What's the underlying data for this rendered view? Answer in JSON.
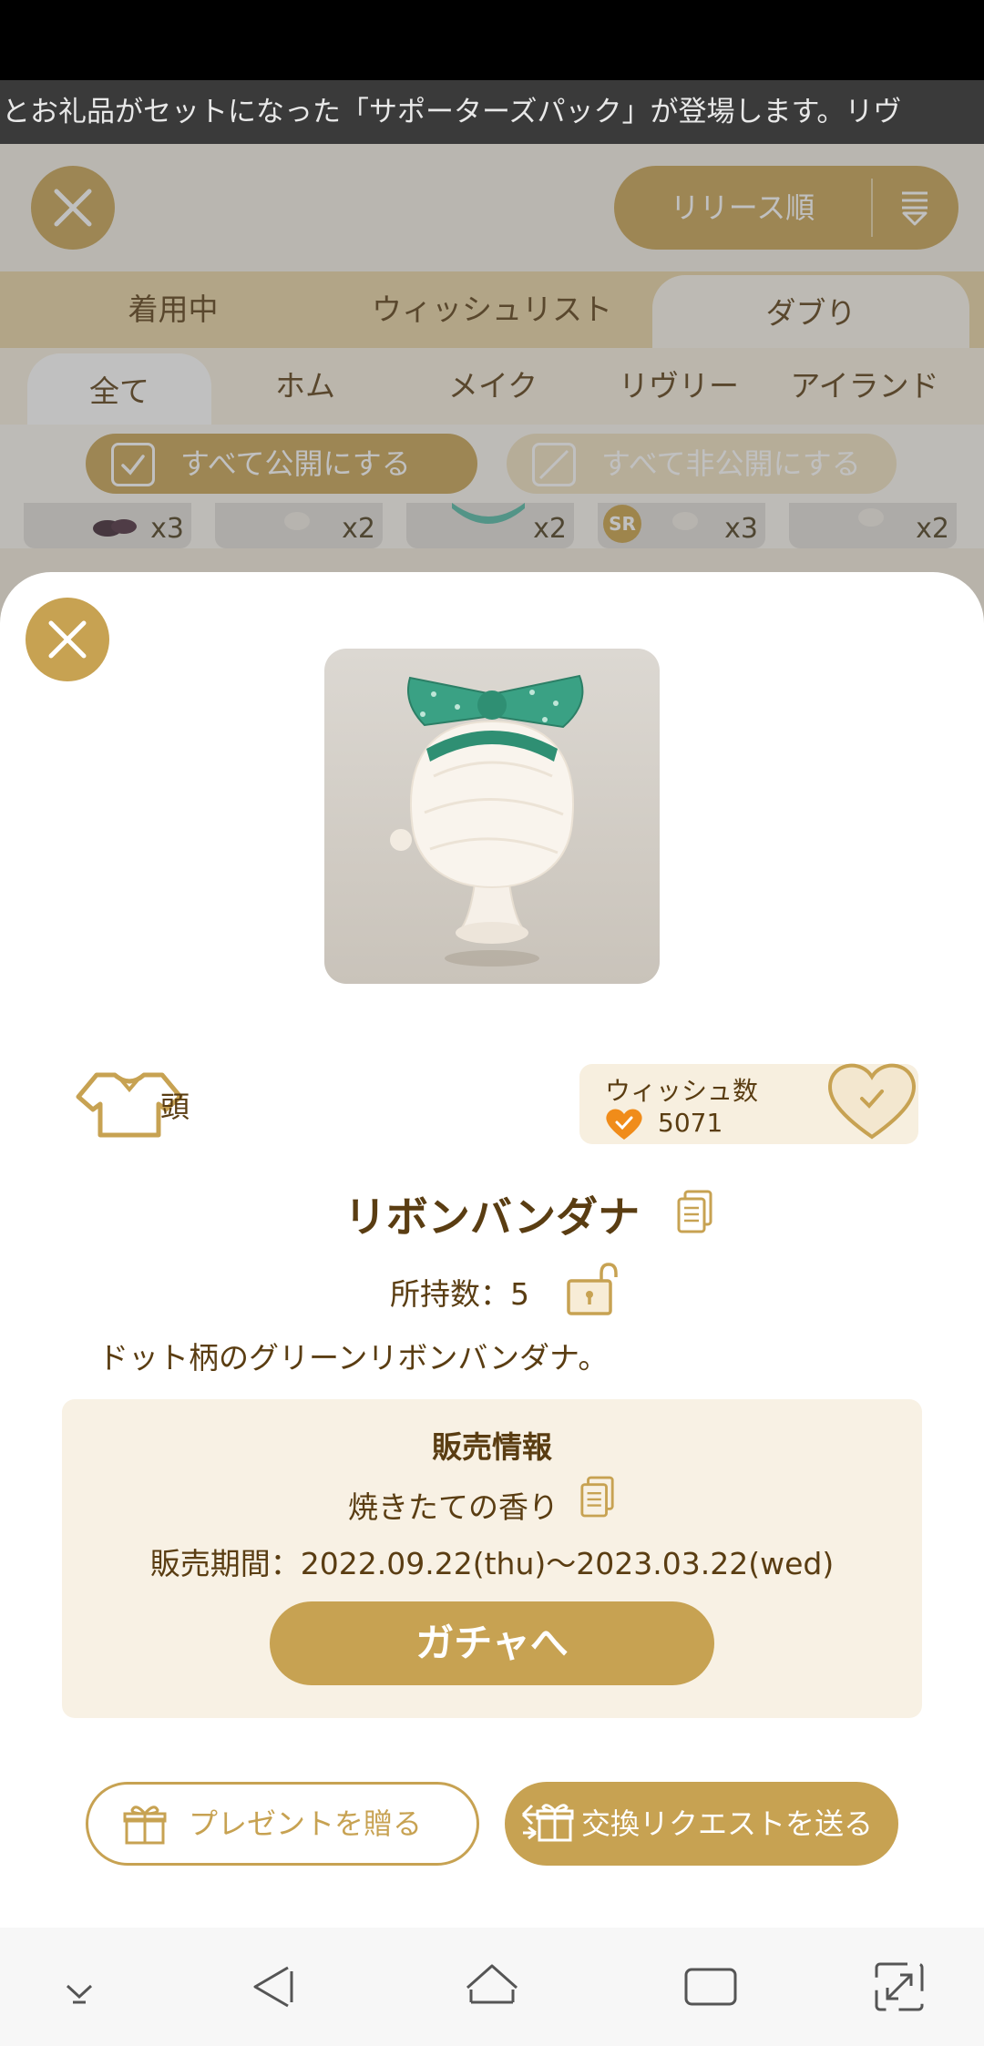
{
  "ticker": {
    "text": "とお礼品がセットになった「サポーターズパック」が登場します。リヴ"
  },
  "header": {
    "sort_label": "リリース順"
  },
  "tabs_primary": [
    "着用中",
    "ウィッシュリスト",
    "ダブり"
  ],
  "tabs_secondary": [
    "全て",
    "ホム",
    "メイク",
    "リヴリー",
    "アイランド"
  ],
  "filters": {
    "public_all": "すべて公開にする",
    "private_all": "すべて非公開にする"
  },
  "items": [
    {
      "count": "x3"
    },
    {
      "count": "x2"
    },
    {
      "count": "x2"
    },
    {
      "count": "x3",
      "badge": "SR"
    },
    {
      "count": "x2"
    }
  ],
  "detail": {
    "category": "頭",
    "wish_title": "ウィッシュ数",
    "wish_count": "5071",
    "item_name": "リボンバンダナ",
    "owned": "所持数：5",
    "description": "ドット柄のグリーンリボンバンダナ。",
    "sale": {
      "title": "販売情報",
      "name": "焼きたての香り",
      "period": "販売期間：2022.09.22(thu)～2023.03.22(wed)",
      "gacha_button": "ガチャへ"
    },
    "present_button": "プレゼントを贈る",
    "exchange_button": "交換リクエストを送る"
  },
  "colors": {
    "accent": "#c7a252",
    "text": "#5a3d12",
    "sale_bg": "#f8f1e4",
    "wish_heart": "#f08c1a"
  }
}
